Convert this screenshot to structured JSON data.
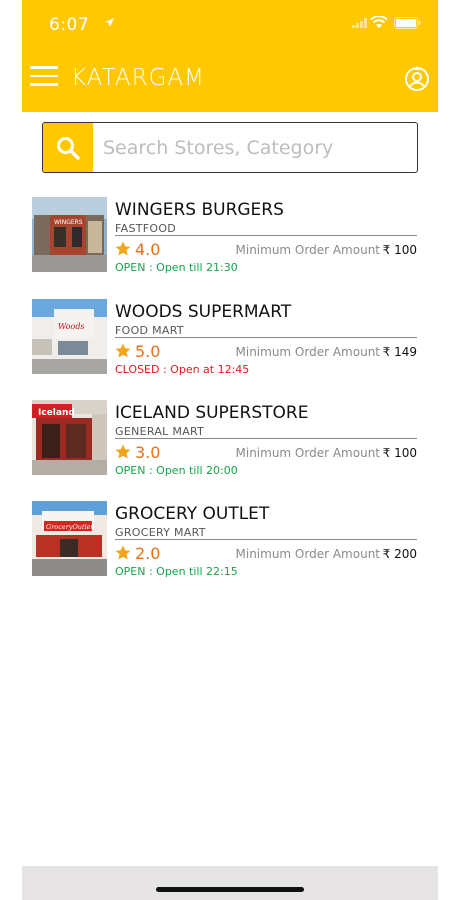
{
  "status_bar": {
    "time": "6:07"
  },
  "header": {
    "city": "KATARGAM"
  },
  "search": {
    "placeholder": "Search Stores, Category",
    "value": ""
  },
  "stores": [
    {
      "name": "WINGERS BURGERS",
      "category": "FASTFOOD",
      "rating": "4.0",
      "min_label": "Minimum Order Amount",
      "amount": "₹ 100",
      "status": "OPEN : Open till 21:30",
      "open": true
    },
    {
      "name": "WOODS SUPERMART",
      "category": "FOOD MART",
      "rating": "5.0",
      "min_label": "Minimum Order Amount",
      "amount": "₹ 149",
      "status": "CLOSED : Open at 12:45",
      "open": false
    },
    {
      "name": "ICELAND SUPERSTORE",
      "category": "GENERAL MART",
      "rating": "3.0",
      "min_label": "Minimum Order Amount",
      "amount": "₹ 100",
      "status": "OPEN : Open till 20:00",
      "open": true
    },
    {
      "name": "GROCERY OUTLET",
      "category": "GROCERY MART",
      "rating": "2.0",
      "min_label": "Minimum Order Amount",
      "amount": "₹ 200",
      "status": "OPEN : Open till 22:15",
      "open": true
    }
  ],
  "thumb_signs": [
    "WINGERS",
    "Woods",
    "Iceland",
    "GroceryOutlet"
  ],
  "colors": {
    "brand": "#FFC800",
    "rating": "#E8711C",
    "open": "#1aa34a",
    "closed": "#e01b1b"
  }
}
